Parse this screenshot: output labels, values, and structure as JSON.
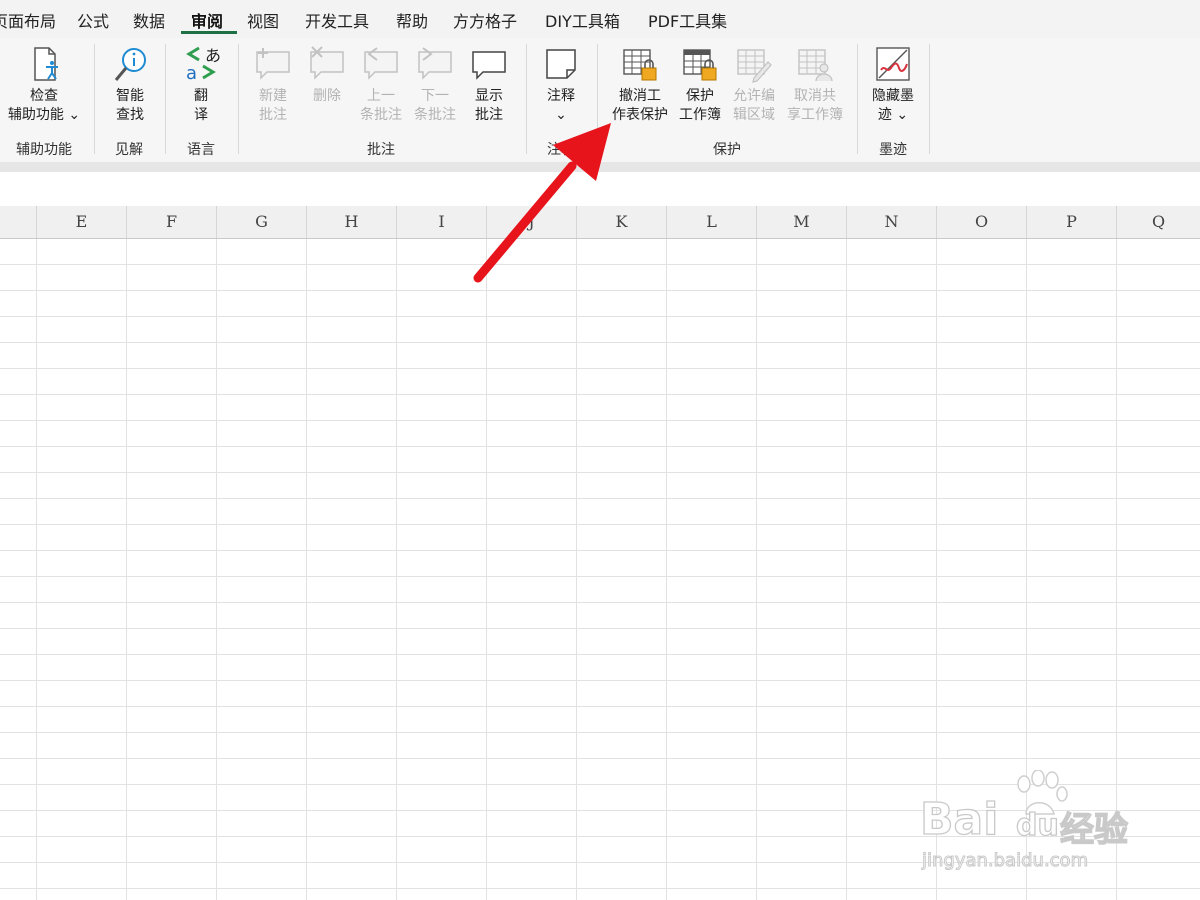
{
  "menu": {
    "tabs": [
      "页面布局",
      "公式",
      "数据",
      "审阅",
      "视图",
      "开发工具",
      "帮助",
      "方方格子",
      "DIY工具箱",
      "PDF工具集"
    ],
    "active_tab": "审阅"
  },
  "ribbon": {
    "groups": {
      "accessibility": "辅助功能",
      "insights": "见解",
      "language": "语言",
      "comments": "批注",
      "notes": "注释",
      "protect": "保护",
      "ink": "墨迹"
    },
    "buttons": {
      "check_accessibility": [
        "检查",
        "辅助功能 ⌄"
      ],
      "smart_lookup": [
        "智能",
        "查找"
      ],
      "translate": [
        "翻",
        "译"
      ],
      "new_comment": [
        "新建",
        "批注"
      ],
      "delete": [
        "删除"
      ],
      "previous_comment": [
        "上一",
        "条批注"
      ],
      "next_comment": [
        "下一",
        "条批注"
      ],
      "show_comments": [
        "显示",
        "批注"
      ],
      "notes": [
        "注释",
        "⌄"
      ],
      "unprotect_sheet": [
        "撤消工",
        "作表保护"
      ],
      "protect_workbook": [
        "保护",
        "工作簿"
      ],
      "allow_edit_ranges": [
        "允许编",
        "辑区域"
      ],
      "unshare_workbook": [
        "取消共",
        "享工作簿"
      ],
      "hide_ink": [
        "隐藏墨",
        "迹 ⌄"
      ]
    }
  },
  "columns": [
    "E",
    "F",
    "G",
    "H",
    "I",
    "J",
    "K",
    "L",
    "M",
    "N",
    "O",
    "P",
    "Q"
  ],
  "watermark": {
    "brand": "Bai",
    "brand2": "du",
    "cn": "经验",
    "url": "jingyan.baidu.com"
  },
  "colors": {
    "active_tab_underline": "#1e7145",
    "arrow": "#e8141c",
    "disabled_text": "#b3b3b3"
  }
}
